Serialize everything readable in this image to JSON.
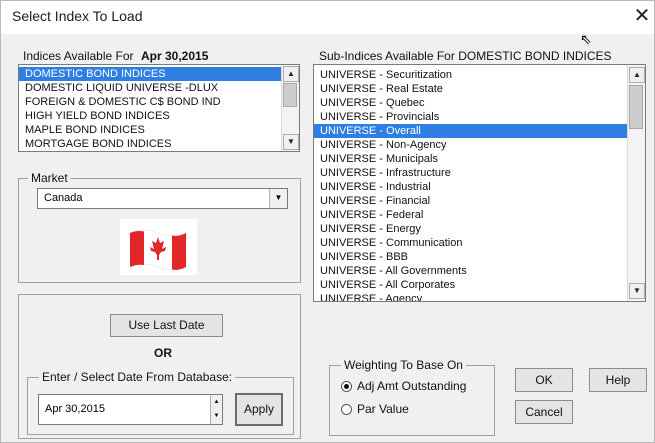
{
  "window": {
    "title": "Select Index To Load",
    "close_glyph": "✕",
    "cursor_glyph": "⇖"
  },
  "indices": {
    "label": "Indices Available For",
    "date": "Apr 30,2015",
    "items": [
      "DOMESTIC BOND INDICES",
      "DOMESTIC LIQUID UNIVERSE -DLUX",
      "FOREIGN & DOMESTIC C$ BOND IND",
      "HIGH YIELD BOND INDICES",
      "MAPLE BOND INDICES",
      "MORTGAGE BOND INDICES"
    ],
    "selected_index": 0
  },
  "subindices": {
    "label": "Sub-Indices Available For DOMESTIC BOND INDICES",
    "items": [
      "UNIVERSE - Securitization",
      "UNIVERSE - Real Estate",
      "UNIVERSE - Quebec",
      "UNIVERSE - Provincials",
      "UNIVERSE - Overall",
      "UNIVERSE - Non-Agency",
      "UNIVERSE - Municipals",
      "UNIVERSE - Infrastructure",
      "UNIVERSE - Industrial",
      "UNIVERSE - Financial",
      "UNIVERSE - Federal",
      "UNIVERSE - Energy",
      "UNIVERSE - Communication",
      "UNIVERSE - BBB",
      "UNIVERSE - All Governments",
      "UNIVERSE - All Corporates",
      "UNIVERSE - Agency"
    ],
    "selected_index": 4
  },
  "market": {
    "legend": "Market",
    "value": "Canada"
  },
  "date_section": {
    "use_last_date_label": "Use Last Date",
    "or_label": "OR",
    "legend": "Enter / Select Date From Database:",
    "date_value": "Apr 30,2015",
    "apply_label": "Apply"
  },
  "weighting": {
    "legend": "Weighting To Base On",
    "options": [
      "Adj Amt Outstanding",
      "Par Value"
    ],
    "selected_index": 0
  },
  "buttons": {
    "ok": "OK",
    "help": "Help",
    "cancel": "Cancel"
  },
  "colors": {
    "selection": "#2f7fe3",
    "flag_red": "#e3262a"
  }
}
